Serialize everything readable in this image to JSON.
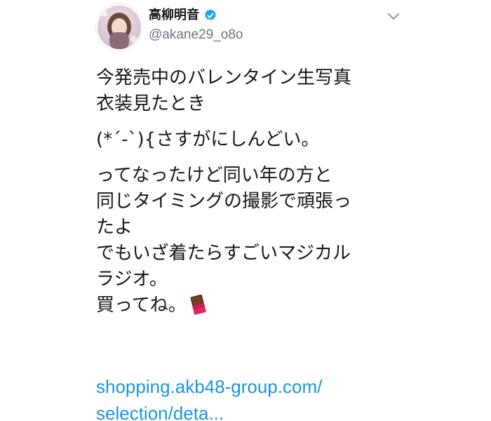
{
  "user": {
    "display_name": "高柳明音",
    "handle": "@akane29_o8o"
  },
  "icons": {
    "verified": "verified-badge-icon",
    "caret": "chevron-down-icon",
    "emoji": "chocolate-bar-icon"
  },
  "tweet": {
    "lines": [
      "今発売中のバレンタイン生写真",
      "衣装見たとき",
      "(*´-`){さすがにしんどい。",
      "ってなったけど同い年の方と",
      "同じタイミングの撮影で頑張っ",
      "たよ",
      "でもいざ着たらすごいマジカル",
      "ラジオ。",
      "買ってね。"
    ],
    "link_lines": [
      "shopping.akb48-group.com/",
      "selection/deta..."
    ]
  },
  "colors": {
    "text": "#14171a",
    "secondary": "#657786",
    "link": "#1b95e0",
    "verified": "#1da1f2"
  }
}
